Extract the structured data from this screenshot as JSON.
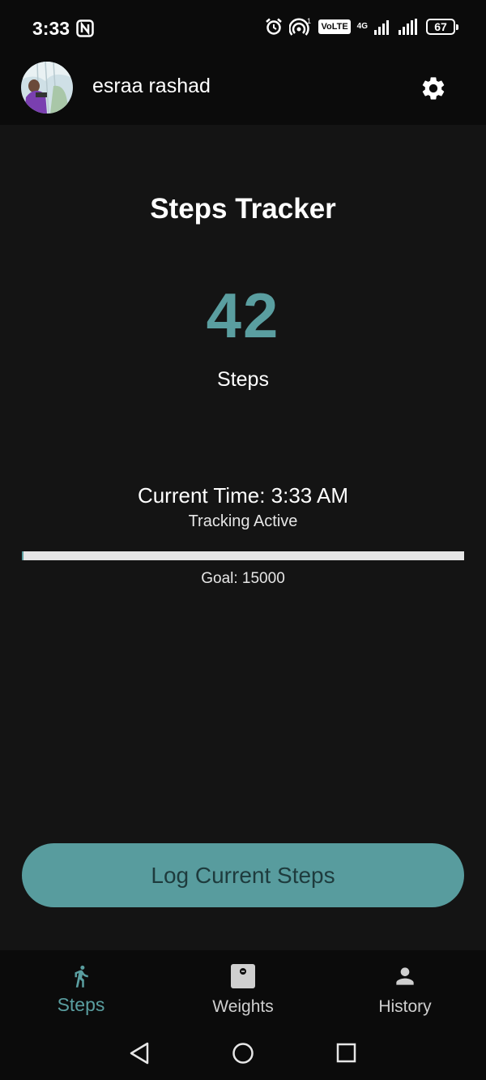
{
  "status_bar": {
    "time": "3:33",
    "volte": "VoLTE",
    "network": "4G",
    "battery": "67"
  },
  "header": {
    "username": "esraa rashad"
  },
  "main": {
    "title": "Steps Tracker",
    "step_count": "42",
    "step_unit": "Steps",
    "current_time": "Current Time: 3:33 AM",
    "tracking_status": "Tracking Active",
    "goal": "Goal: 15000",
    "progress_fraction": 0.0028,
    "log_button": "Log Current Steps"
  },
  "bottom_nav": {
    "items": [
      {
        "label": "Steps",
        "icon": "walk-icon",
        "active": true
      },
      {
        "label": "Weights",
        "icon": "scale-icon",
        "active": false
      },
      {
        "label": "History",
        "icon": "person-icon",
        "active": false
      }
    ]
  },
  "colors": {
    "accent": "#5a9ea0",
    "background": "#141414",
    "bar_background": "#0b0b0b",
    "button_text": "#1e3b3d"
  }
}
